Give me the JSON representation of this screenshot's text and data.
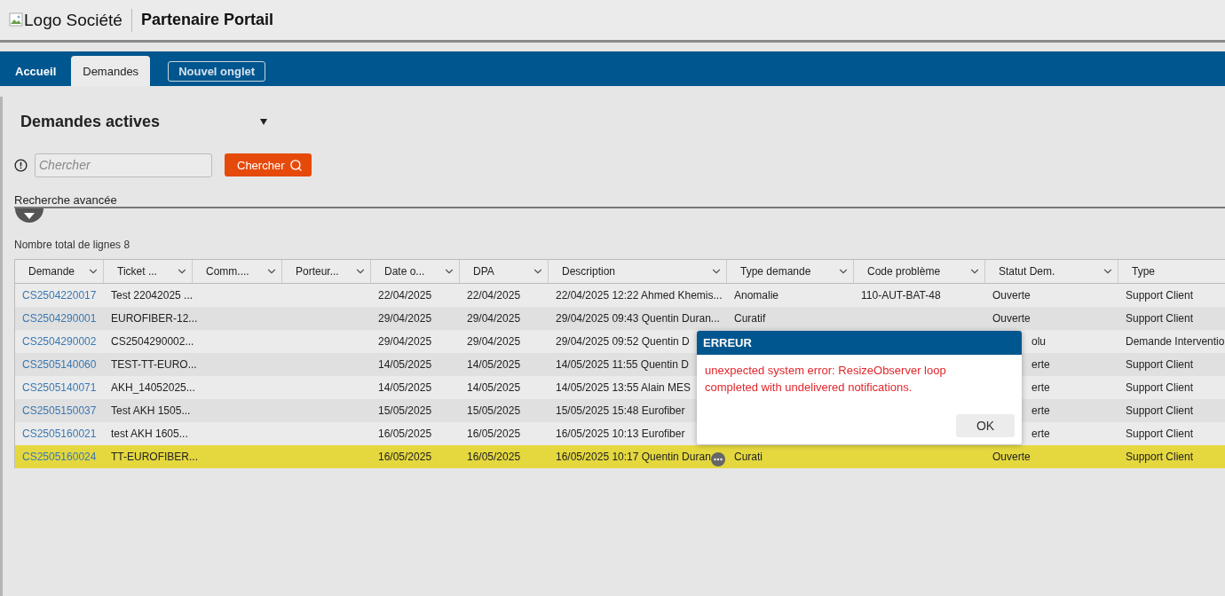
{
  "header": {
    "logo_alt": "Logo Société",
    "title": "Partenaire Portail"
  },
  "tabs": [
    {
      "label": "Accueil",
      "selected": false,
      "kind": "tab"
    },
    {
      "label": "Demandes",
      "selected": true,
      "kind": "tab"
    },
    {
      "label": "Nouvel onglet",
      "selected": false,
      "kind": "new"
    }
  ],
  "view_selector": {
    "value": "Demandes actives"
  },
  "search": {
    "placeholder": "Chercher",
    "button": "Chercher"
  },
  "advanced_search": {
    "label": "Recherche avancée",
    "expanded": false
  },
  "row_count": "Nombre total de lignes 8",
  "table": {
    "columns": [
      {
        "label": "Demande",
        "menu": true
      },
      {
        "label": "Ticket ...",
        "menu": true
      },
      {
        "label": "Comm....",
        "menu": true
      },
      {
        "label": "Porteur...",
        "menu": true
      },
      {
        "label": "Date o...",
        "menu": true
      },
      {
        "label": "DPA",
        "menu": true
      },
      {
        "label": "Description",
        "menu": true
      },
      {
        "label": "Type demande",
        "menu": true
      },
      {
        "label": "Code problème",
        "menu": true
      },
      {
        "label": "Statut Dem.",
        "menu": true
      },
      {
        "label": "Type",
        "menu": false
      }
    ],
    "rows": [
      {
        "selected": false,
        "cells": [
          "CS2504220017",
          "Test 22042025 ...",
          "",
          "",
          "22/04/2025",
          "22/04/2025",
          "22/04/2025 12:22 Ahmed Khemis...",
          "Anomalie",
          "110-AUT-BAT-48",
          "Ouverte",
          "Support Client"
        ]
      },
      {
        "selected": false,
        "cells": [
          "CS2504290001",
          "EUROFIBER-12...",
          "",
          "",
          "29/04/2025",
          "29/04/2025",
          "29/04/2025 09:43 Quentin Duran...",
          "Curatif",
          "",
          "Ouverte",
          "Support Client"
        ]
      },
      {
        "selected": false,
        "covered": true,
        "cells": [
          "CS2504290002",
          "CS2504290002...",
          "",
          "",
          "29/04/2025",
          "29/04/2025",
          "29/04/2025 09:52 Quentin D",
          "",
          "",
          "olu",
          "Demande Interventio"
        ]
      },
      {
        "selected": false,
        "covered": true,
        "cells": [
          "CS2505140060",
          "TEST-TT-EURO...",
          "",
          "",
          "14/05/2025",
          "14/05/2025",
          "14/05/2025 11:55 Quentin D",
          "",
          "",
          "erte",
          "Support Client"
        ]
      },
      {
        "selected": false,
        "covered": true,
        "cells": [
          "CS2505140071",
          "AKH_14052025...",
          "",
          "",
          "14/05/2025",
          "14/05/2025",
          "14/05/2025 13:55 Alain MES",
          "",
          "",
          "erte",
          "Support Client"
        ]
      },
      {
        "selected": false,
        "covered": true,
        "cells": [
          "CS2505150037",
          "Test AKH 1505...",
          "",
          "",
          "15/05/2025",
          "15/05/2025",
          "15/05/2025 15:48 Eurofiber",
          "",
          "",
          "erte",
          "Support Client"
        ]
      },
      {
        "selected": false,
        "covered": true,
        "cells": [
          "CS2505160021",
          "test AKH 1605...",
          "",
          "",
          "16/05/2025",
          "16/05/2025",
          "16/05/2025 10:13 Eurofiber",
          "",
          "",
          "erte",
          "Support Client"
        ]
      },
      {
        "selected": true,
        "more": true,
        "cells": [
          "CS2505160024",
          "TT-EUROFIBER...",
          "",
          "",
          "16/05/2025",
          "16/05/2025",
          "16/05/2025 10:17 Quentin Duran",
          "Curati",
          "",
          "Ouverte",
          "Support Client"
        ]
      }
    ]
  },
  "dialog": {
    "title": "ERREUR",
    "message": "unexpected system error: ResizeObserver loop completed with undelivered notifications.",
    "button": "OK"
  }
}
